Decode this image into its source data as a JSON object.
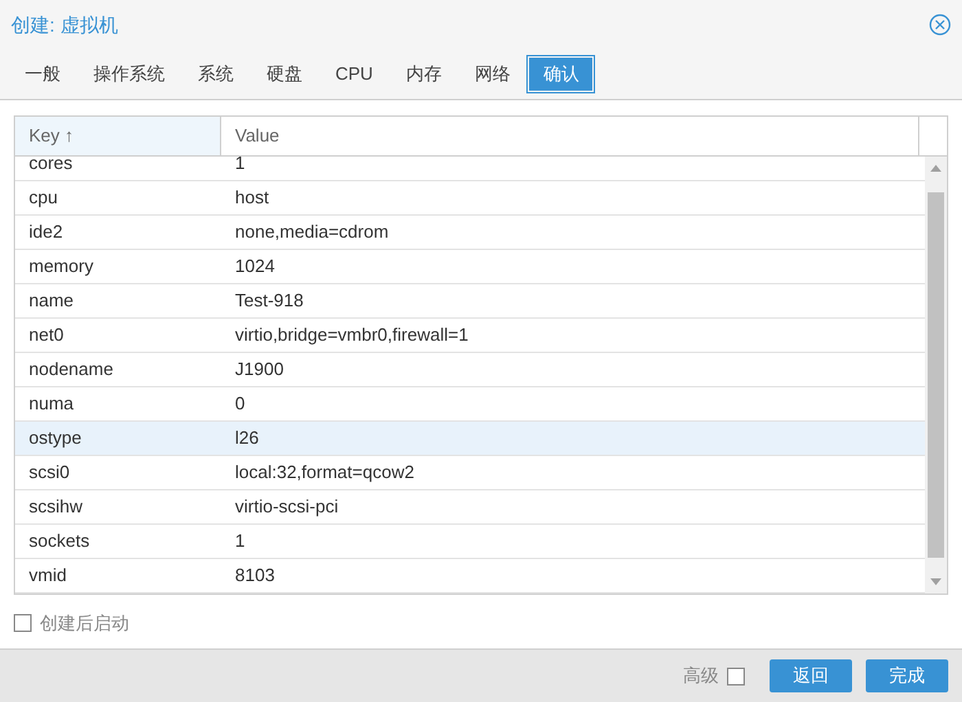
{
  "window": {
    "title": "创建: 虚拟机"
  },
  "tabs": [
    {
      "label": "一般",
      "selected": false
    },
    {
      "label": "操作系统",
      "selected": false
    },
    {
      "label": "系统",
      "selected": false
    },
    {
      "label": "硬盘",
      "selected": false
    },
    {
      "label": "CPU",
      "selected": false
    },
    {
      "label": "内存",
      "selected": false
    },
    {
      "label": "网络",
      "selected": false
    },
    {
      "label": "确认",
      "selected": true
    }
  ],
  "table": {
    "columns": [
      {
        "label": "Key ↑",
        "sorted": true
      },
      {
        "label": "Value",
        "sorted": false
      }
    ],
    "rows": [
      {
        "key": "cores",
        "value": "1",
        "selected": false
      },
      {
        "key": "cpu",
        "value": "host",
        "selected": false
      },
      {
        "key": "ide2",
        "value": "none,media=cdrom",
        "selected": false
      },
      {
        "key": "memory",
        "value": "1024",
        "selected": false
      },
      {
        "key": "name",
        "value": "Test-918",
        "selected": false
      },
      {
        "key": "net0",
        "value": "virtio,bridge=vmbr0,firewall=1",
        "selected": false
      },
      {
        "key": "nodename",
        "value": "J1900",
        "selected": false
      },
      {
        "key": "numa",
        "value": "0",
        "selected": false
      },
      {
        "key": "ostype",
        "value": "l26",
        "selected": true
      },
      {
        "key": "scsi0",
        "value": "local:32,format=qcow2",
        "selected": false
      },
      {
        "key": "scsihw",
        "value": "virtio-scsi-pci",
        "selected": false
      },
      {
        "key": "sockets",
        "value": "1",
        "selected": false
      },
      {
        "key": "vmid",
        "value": "8103",
        "selected": false
      }
    ]
  },
  "start_after_create": {
    "label": "创建后启动",
    "checked": false
  },
  "footer": {
    "advanced": {
      "label": "高级",
      "checked": false
    },
    "buttons": [
      "返回",
      "完成"
    ]
  }
}
